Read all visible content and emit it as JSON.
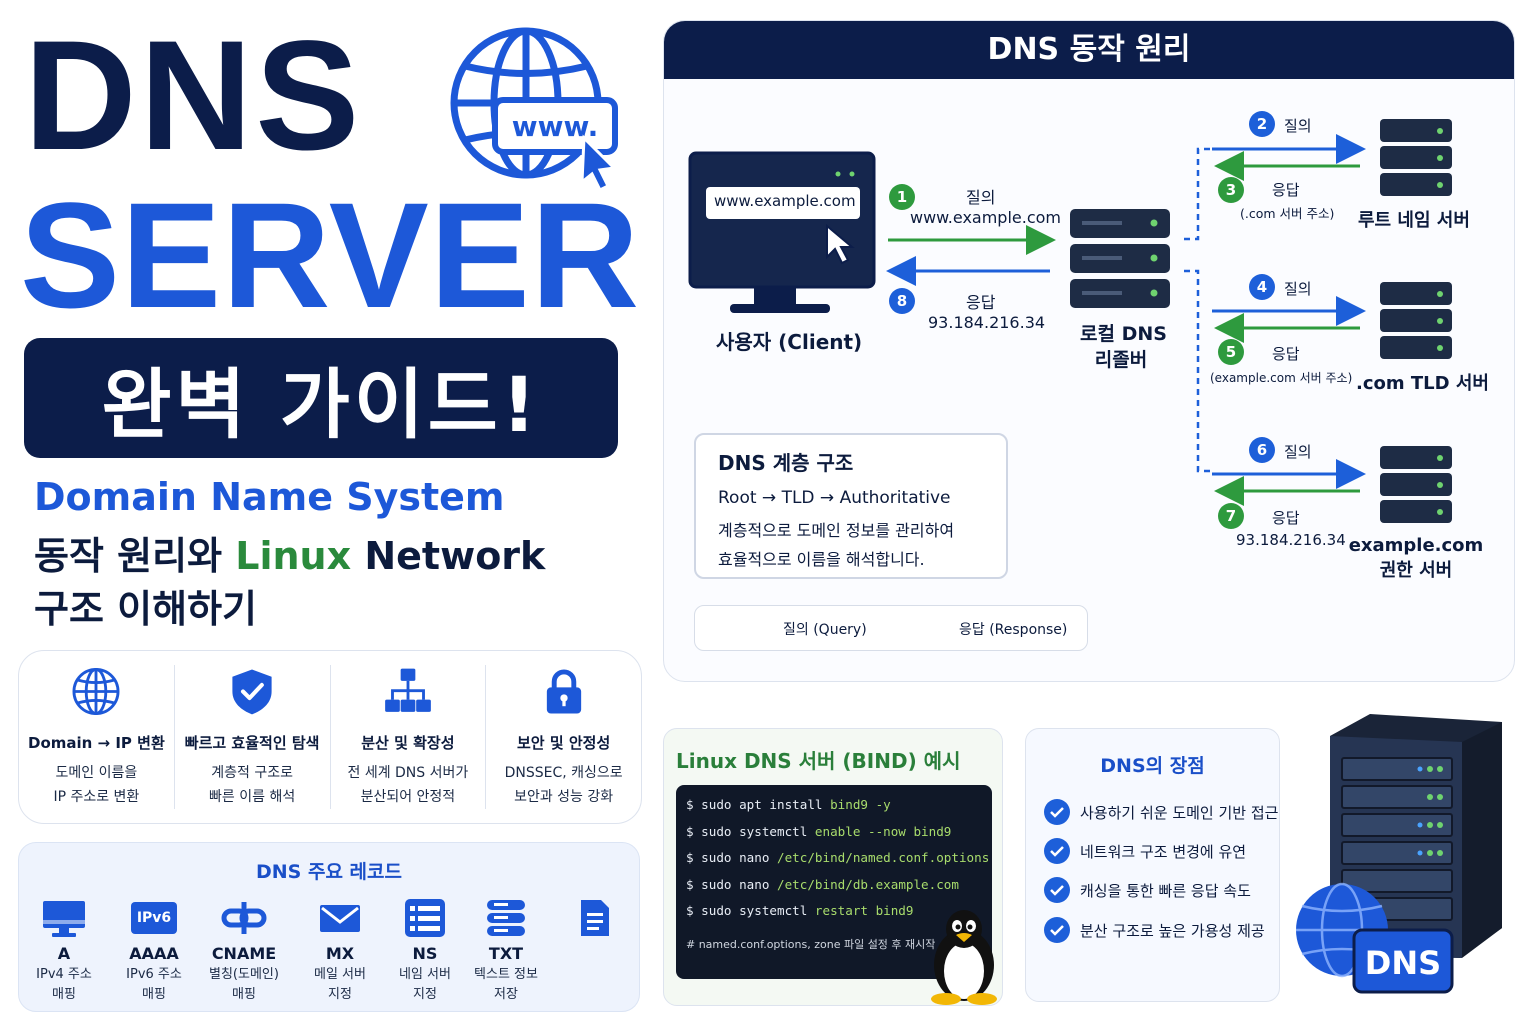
{
  "hero": {
    "title_dns": "DNS",
    "title_server": "SERVER",
    "guide": "완벽 가이드!",
    "www": "www.",
    "subtitle_en": "Domain Name System",
    "subtitle_line2_a": "동작 원리와 ",
    "subtitle_line2_linux": "Linux",
    "subtitle_line2_b": " Network",
    "subtitle_line3": "구조 이해하기"
  },
  "features": [
    {
      "icon": "globe-icon",
      "title": "Domain → IP 변환",
      "desc1": "도메인 이름을",
      "desc2": "IP 주소로 변환"
    },
    {
      "icon": "shield-check-icon",
      "title": "빠르고 효율적인 탐색",
      "desc1": "계층적 구조로",
      "desc2": "빠른 이름 해석"
    },
    {
      "icon": "network-tree-icon",
      "title": "분산 및 확장성",
      "desc1": "전 세계 DNS 서버가",
      "desc2": "분산되어 안정적"
    },
    {
      "icon": "lock-icon",
      "title": "보안 및 안정성",
      "desc1": "DNSSEC, 캐싱으로",
      "desc2": "보안과 성능 강화"
    }
  ],
  "records": {
    "title": "DNS 주요 레코드",
    "ipv6_badge": "IPv6",
    "items": [
      {
        "icon": "monitor-icon",
        "name": "A",
        "desc1": "IPv4 주소",
        "desc2": "매핑"
      },
      {
        "icon": "ipv6-icon",
        "name": "AAAA",
        "desc1": "IPv6 주소",
        "desc2": "매핑"
      },
      {
        "icon": "link-icon",
        "name": "CNAME",
        "desc1": "별칭(도메인)",
        "desc2": "매핑"
      },
      {
        "icon": "mail-icon",
        "name": "MX",
        "desc1": "메일 서버",
        "desc2": "지정"
      },
      {
        "icon": "server-list-icon",
        "name": "NS",
        "desc1": "네임 서버",
        "desc2": "지정"
      },
      {
        "icon": "database-icon",
        "name": "TXT",
        "desc1": "텍스트 정보",
        "desc2": "저장"
      },
      {
        "icon": "document-icon",
        "name": "",
        "desc1": "",
        "desc2": ""
      }
    ]
  },
  "flow": {
    "title": "DNS 동작 원리",
    "client_url": "www.example.com",
    "client_label": "사용자 (Client)",
    "resolver_label1": "로컬 DNS",
    "resolver_label2": "리졸버",
    "step1_num": "1",
    "step1_label": "질의",
    "step1_domain": "www.example.com",
    "step8_num": "8",
    "step8_label": "응답",
    "step8_ip": "93.184.216.34",
    "step2_num": "2",
    "step2_label": "질의",
    "step3_num": "3",
    "step3_label": "응답",
    "step3_note": "(.com 서버 주소)",
    "root_label": "루트 네임 서버",
    "step4_num": "4",
    "step4_label": "질의",
    "step5_num": "5",
    "step5_label": "응답",
    "step5_note": "(example.com 서버 주소)",
    "tld_label": ".com TLD 서버",
    "step6_num": "6",
    "step6_label": "질의",
    "step7_num": "7",
    "step7_label": "응답",
    "step7_ip": "93.184.216.34",
    "auth_label1": "example.com",
    "auth_label2": "권한 서버",
    "hierarchy": {
      "title": "DNS 계층 구조",
      "path": "Root → TLD → Authoritative",
      "desc1": "계층적으로 도메인 정보를 관리하여",
      "desc2": "효율적으로 이름을 해석합니다."
    },
    "legend": {
      "query": "질의 (Query)",
      "response": "응답 (Response)"
    },
    "colors": {
      "query": "#1d5fd9",
      "response": "#2e9a3e",
      "navy": "#0c1d4a"
    }
  },
  "bind": {
    "title": "Linux DNS 서버 (BIND) 예시",
    "lines": [
      {
        "prompt": "$ ",
        "cmd": "sudo apt install ",
        "arg": "bind9 -y"
      },
      {
        "prompt": "$ ",
        "cmd": "sudo systemctl ",
        "arg": "enable --now bind9"
      },
      {
        "prompt": "$ ",
        "cmd": "sudo nano ",
        "arg": "/etc/bind/named.conf.options"
      },
      {
        "prompt": "$ ",
        "cmd": "sudo nano ",
        "arg": "/etc/bind/db.example.com"
      },
      {
        "prompt": "$ ",
        "cmd": "sudo systemctl ",
        "arg": "restart bind9"
      }
    ],
    "comment": "# named.conf.options, zone 파일 설정 후 재시작"
  },
  "advantages": {
    "title": "DNS의 장점",
    "items": [
      "사용하기 쉬운 도메인 기반 접근",
      "네트워크 구조 변경에 유연",
      "캐싱을 통한 빠른 응답 속도",
      "분산 구조로 높은 가용성 제공"
    ]
  },
  "server_badge": "DNS"
}
